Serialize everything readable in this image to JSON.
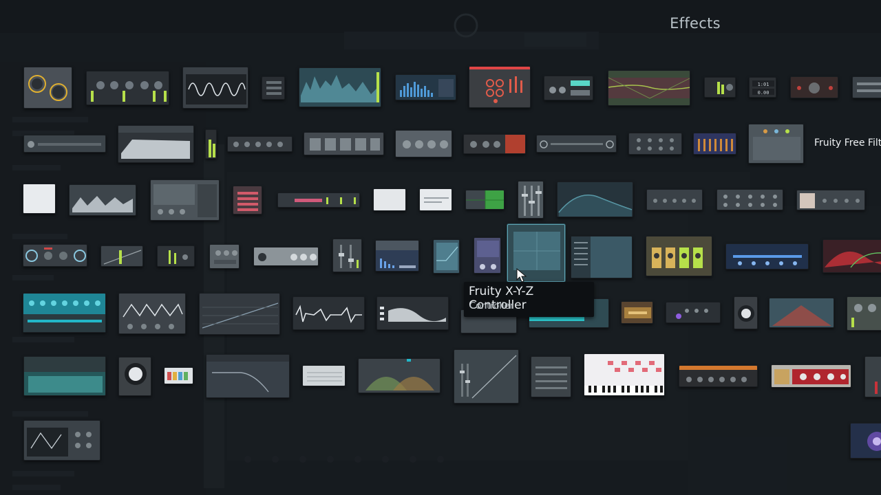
{
  "browser": {
    "title": "Effects",
    "tooltip": {
      "title": "Fruity X-Y-Z Controller",
      "subtitle": "Controller"
    },
    "visible_label": "Fruity Free Filte"
  },
  "icons": {
    "cursor": "arrow-cursor-icon",
    "logo": "fl-studio-logo-icon"
  },
  "colors": {
    "background": "#20262b",
    "tooltip_bg": "#0d1013",
    "highlight": "#5fa4b3",
    "accent_green": "#b6e04a",
    "accent_cyan": "#22b7c8",
    "accent_red": "#c8323a"
  }
}
